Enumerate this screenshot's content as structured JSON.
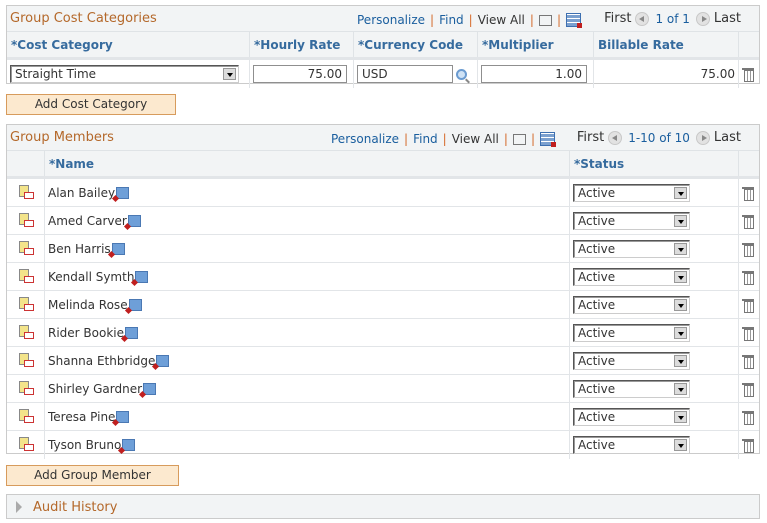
{
  "cost_categories": {
    "title": "Group Cost Categories",
    "nav": {
      "personalize": "Personalize",
      "find": "Find",
      "view_all": "View All"
    },
    "pager": {
      "first": "First",
      "count": "1 of 1",
      "last": "Last"
    },
    "columns": [
      "*Cost Category",
      "*Hourly Rate",
      "*Currency Code",
      "*Multiplier",
      "Billable Rate"
    ],
    "row": {
      "cost_category": "Straight Time",
      "hourly_rate": "75.00",
      "currency_code": "USD",
      "multiplier": "1.00",
      "billable_rate": "75.00"
    },
    "add_button": "Add Cost Category"
  },
  "group_members": {
    "title": "Group Members",
    "nav": {
      "personalize": "Personalize",
      "find": "Find",
      "view_all": "View All"
    },
    "pager": {
      "first": "First",
      "count": "1-10 of 10",
      "last": "Last"
    },
    "columns": {
      "name": "*Name",
      "status": "*Status"
    },
    "rows": [
      {
        "name": "Alan Bailey",
        "status": "Active"
      },
      {
        "name": "Amed Carver",
        "status": "Active"
      },
      {
        "name": "Ben Harris",
        "status": "Active"
      },
      {
        "name": "Kendall Symth",
        "status": "Active"
      },
      {
        "name": "Melinda Rose",
        "status": "Active"
      },
      {
        "name": "Rider Bookie",
        "status": "Active"
      },
      {
        "name": "Shanna Ethbridge",
        "status": "Active"
      },
      {
        "name": "Shirley Gardner",
        "status": "Active"
      },
      {
        "name": "Teresa Pine",
        "status": "Active"
      },
      {
        "name": "Tyson Bruno",
        "status": "Active"
      }
    ],
    "add_button": "Add Group Member"
  },
  "audit": {
    "title": "Audit History"
  }
}
